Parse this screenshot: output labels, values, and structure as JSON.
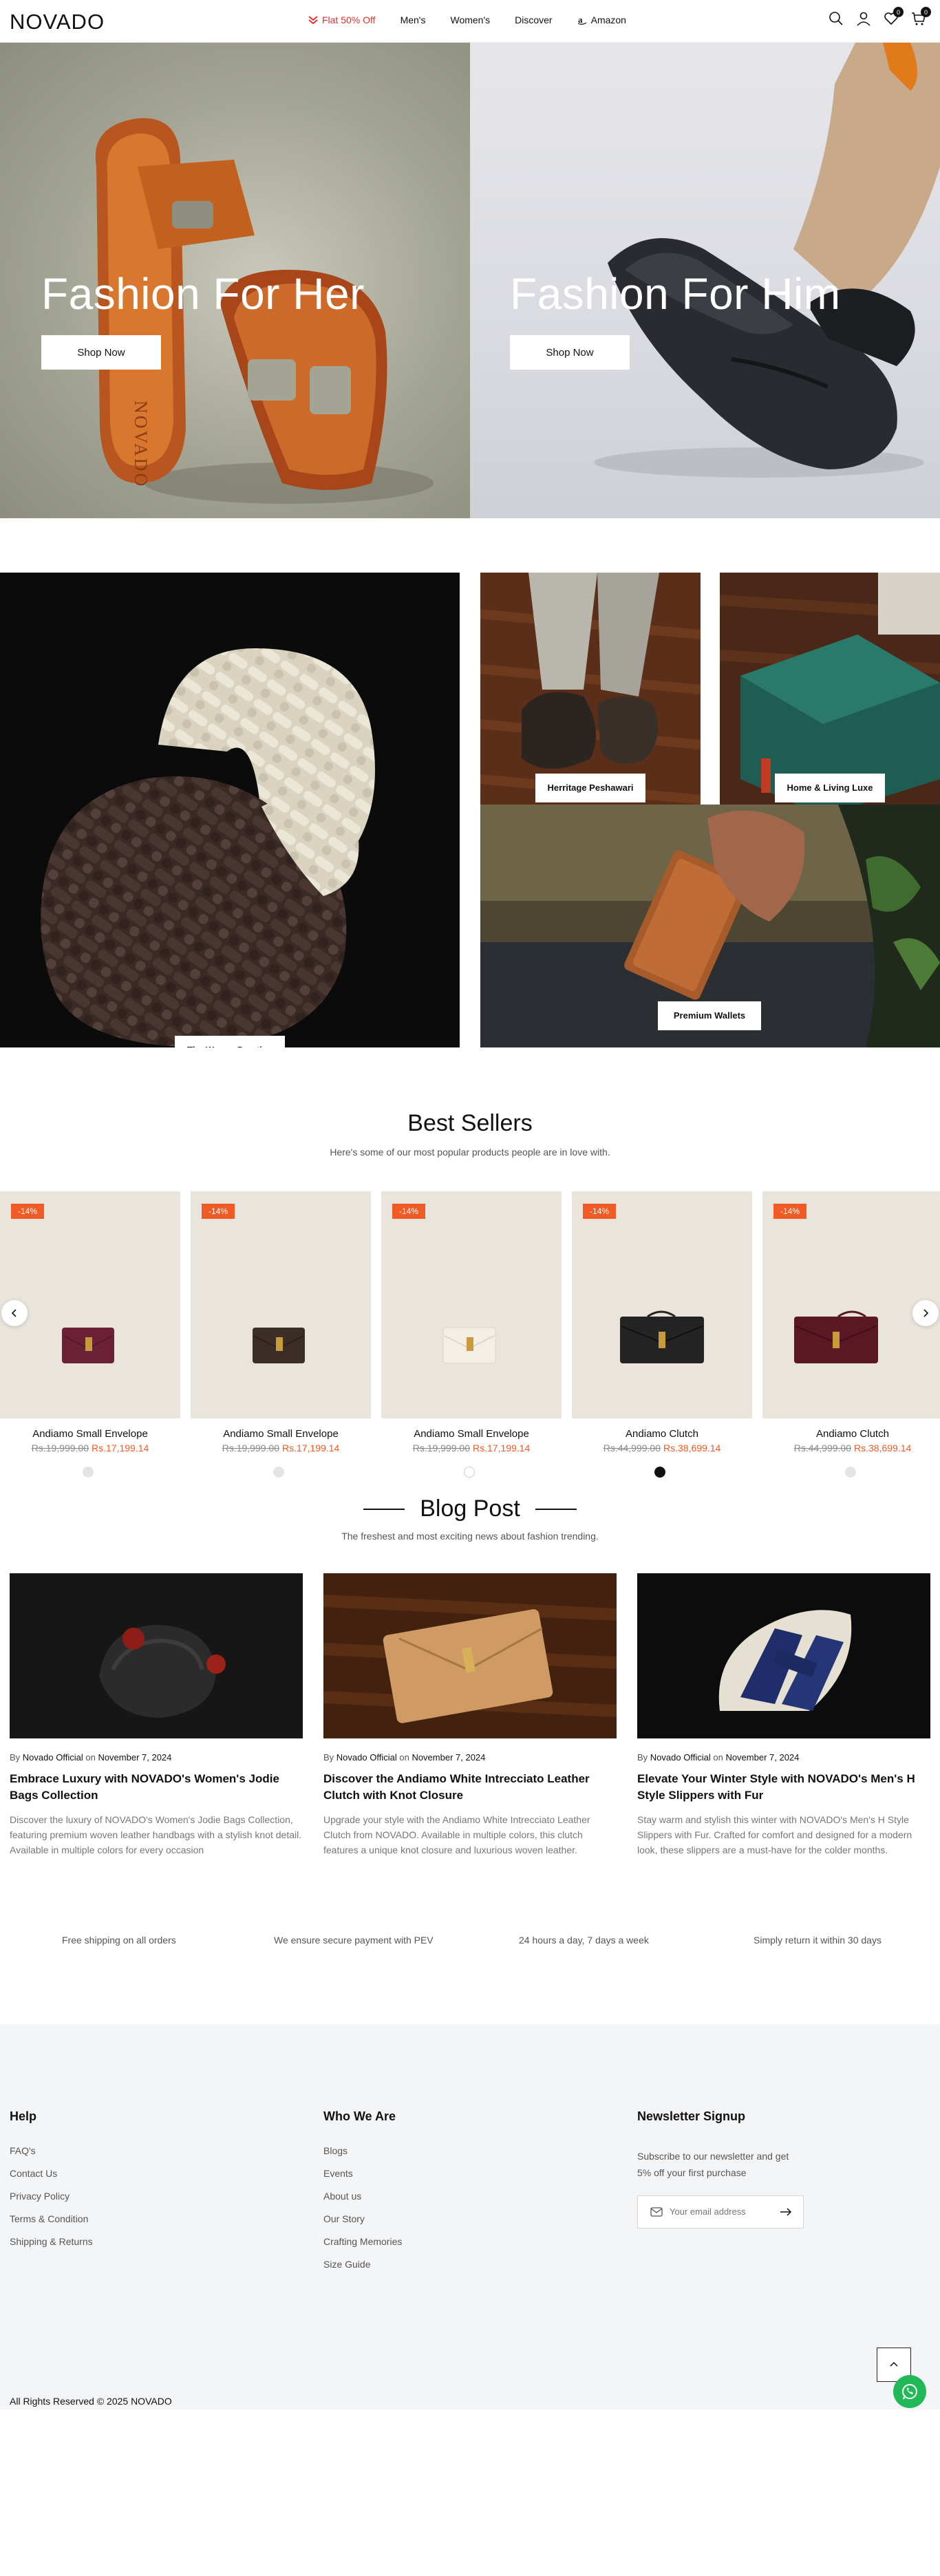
{
  "header": {
    "logo": "NOVADO",
    "nav": {
      "promo": "Flat 50% Off",
      "mens": "Men's",
      "womens": "Women's",
      "discover": "Discover",
      "amazon": "Amazon"
    },
    "wishlist_count": "0",
    "cart_count": "0"
  },
  "hero": {
    "left": {
      "title": "Fashion For Her",
      "button": "Shop Now"
    },
    "right": {
      "title": "Fashion For Him",
      "button": "Shop Now"
    }
  },
  "collections": {
    "woven": "The Woven Prestige",
    "heritage": "Herritage Peshawari",
    "home": "Home & Living Luxe",
    "wallets": "Premium Wallets"
  },
  "best_sellers": {
    "title": "Best Sellers",
    "subtitle": "Here's some of our most popular products people are in love with.",
    "products": [
      {
        "badge": "-14%",
        "name": "Andiamo Small Envelope",
        "old_price": "Rs.19,999.00",
        "price": "Rs.17,199.14",
        "color": "#6b2236"
      },
      {
        "badge": "-14%",
        "name": "Andiamo Small Envelope",
        "old_price": "Rs.19,999.00",
        "price": "Rs.17,199.14",
        "color": "#3a2e27"
      },
      {
        "badge": "-14%",
        "name": "Andiamo Small Envelope",
        "old_price": "Rs.19,999.00",
        "price": "Rs.17,199.14",
        "color": "#f1ede3"
      },
      {
        "badge": "-14%",
        "name": "Andiamo Clutch",
        "old_price": "Rs.44,999.00",
        "price": "Rs.38,699.14",
        "color": "#242424"
      },
      {
        "badge": "-14%",
        "name": "Andiamo Clutch",
        "old_price": "Rs.44,999.00",
        "price": "Rs.38,699.14",
        "color": "#5a1824"
      }
    ]
  },
  "blog": {
    "title": "Blog Post",
    "subtitle": "The freshest and most exciting news about fashion trending.",
    "by": "By",
    "on": "on",
    "posts": [
      {
        "author": "Novado Official",
        "date": "November 7, 2024",
        "title": "Embrace Luxury with NOVADO's Women's Jodie Bags Collection",
        "excerpt": "Discover the luxury of NOVADO's Women's Jodie Bags Collection, featuring premium woven leather handbags with a stylish knot detail. Available in multiple colors for every occasion"
      },
      {
        "author": "Novado Official",
        "date": "November 7, 2024",
        "title": "Discover the Andiamo White Intrecciato Leather Clutch with Knot Closure",
        "excerpt": "Upgrade your style with the Andiamo White Intrecciato Leather Clutch from NOVADO. Available in multiple colors, this clutch features a unique knot closure and luxurious woven leather."
      },
      {
        "author": "Novado Official",
        "date": "November 7, 2024",
        "title": "Elevate Your Winter Style with NOVADO's Men's H Style Slippers with Fur",
        "excerpt": "Stay warm and stylish this winter with NOVADO's Men's H Style Slippers with Fur. Crafted for comfort and designed for a modern look, these slippers are a must-have for the colder months."
      }
    ]
  },
  "features": [
    "Free shipping on all orders",
    "We ensure secure payment with PEV",
    "24 hours a day, 7 days a week",
    "Simply return it within 30 days"
  ],
  "footer": {
    "help": {
      "title": "Help",
      "links": [
        "FAQ's",
        "Contact Us",
        "Privacy Policy",
        "Terms & Condition",
        "Shipping & Returns"
      ]
    },
    "who": {
      "title": "Who We Are",
      "links": [
        "Blogs",
        "Events",
        "About us",
        "Our Story",
        "Crafting Memories",
        "Size Guide"
      ]
    },
    "newsletter": {
      "title": "Newsletter Signup",
      "text": "Subscribe to our newsletter and get 5% off your first purchase",
      "placeholder": "Your email address"
    },
    "copyright": "All Rights Reserved © 2025 NOVADO"
  },
  "colors": {
    "accent": "#f05a24",
    "promo": "#e0302c",
    "whatsapp": "#21b957"
  }
}
